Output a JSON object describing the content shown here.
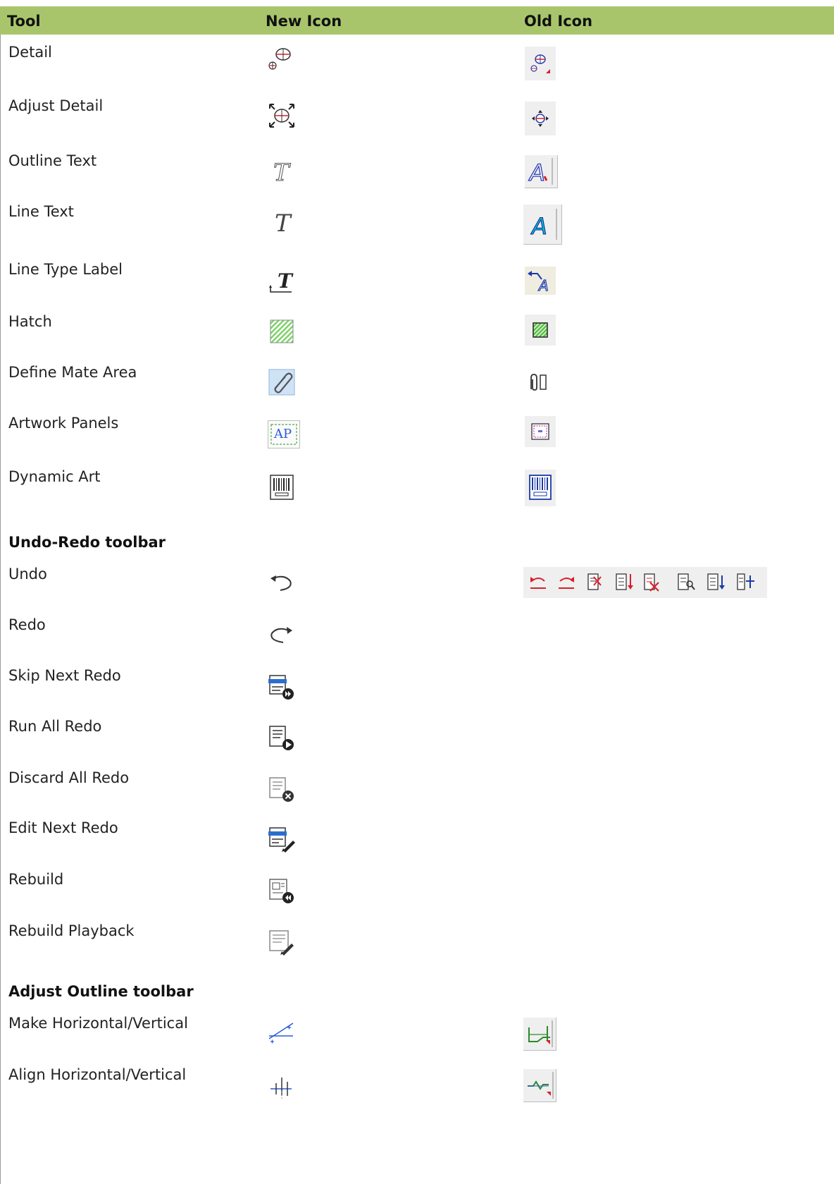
{
  "table": {
    "headers": {
      "tool": "Tool",
      "new_icon": "New Icon",
      "old_icon": "Old Icon"
    },
    "rows": [
      {
        "tool": "Detail",
        "new_icon": "detail-icon",
        "old_icon": "detail-old-icon"
      },
      {
        "tool": "Adjust Detail",
        "new_icon": "adjust-detail-icon",
        "old_icon": "adjust-detail-old-icon"
      },
      {
        "tool": "Outline Text",
        "new_icon": "outline-text-icon",
        "old_icon": "outline-text-old-icon"
      },
      {
        "tool": "Line Text",
        "new_icon": "line-text-icon",
        "old_icon": "line-text-old-icon"
      },
      {
        "tool": "Line Type Label",
        "new_icon": "line-type-label-icon",
        "old_icon": "line-type-label-old-icon"
      },
      {
        "tool": "Hatch",
        "new_icon": "hatch-icon",
        "old_icon": "hatch-old-icon"
      },
      {
        "tool": "Define Mate Area",
        "new_icon": "paperclip-icon",
        "old_icon": "paperclip-old-icon"
      },
      {
        "tool": "Artwork Panels",
        "new_icon": "artwork-panels-icon",
        "new_icon_text": "AP",
        "old_icon": "artwork-panels-old-icon"
      },
      {
        "tool": "Dynamic Art",
        "new_icon": "barcode-icon",
        "old_icon": "barcode-old-icon"
      }
    ],
    "sections": [
      {
        "title": "Undo-Redo toolbar",
        "old_icon": "undo-redo-toolbar-old-icon",
        "rows": [
          {
            "tool": "Undo",
            "new_icon": "undo-icon"
          },
          {
            "tool": "Redo",
            "new_icon": "redo-icon"
          },
          {
            "tool": "Skip Next Redo",
            "new_icon": "skip-next-redo-icon"
          },
          {
            "tool": "Run All Redo",
            "new_icon": "run-all-redo-icon"
          },
          {
            "tool": "Discard All Redo",
            "new_icon": "discard-all-redo-icon"
          },
          {
            "tool": "Edit Next Redo",
            "new_icon": "edit-next-redo-icon"
          },
          {
            "tool": "Rebuild",
            "new_icon": "rebuild-icon"
          },
          {
            "tool": "Rebuild Playback",
            "new_icon": "rebuild-playback-icon"
          }
        ]
      },
      {
        "title": "Adjust Outline toolbar",
        "rows": [
          {
            "tool": "Make Horizontal/Vertical",
            "new_icon": "make-horizontal-vertical-icon",
            "old_icon": "make-horizontal-vertical-old-icon"
          },
          {
            "tool": "Align Horizontal/Vertical",
            "new_icon": "align-horizontal-vertical-icon",
            "old_icon": "align-horizontal-vertical-old-icon"
          }
        ]
      }
    ]
  },
  "colors": {
    "header_bg": "#a9c56c",
    "rule": "#9a9a9a",
    "old_icon_bg": "#efefef",
    "accent_red": "#d8202a",
    "accent_blue": "#2a5bd7",
    "hatch_green": "#7fd36a"
  }
}
